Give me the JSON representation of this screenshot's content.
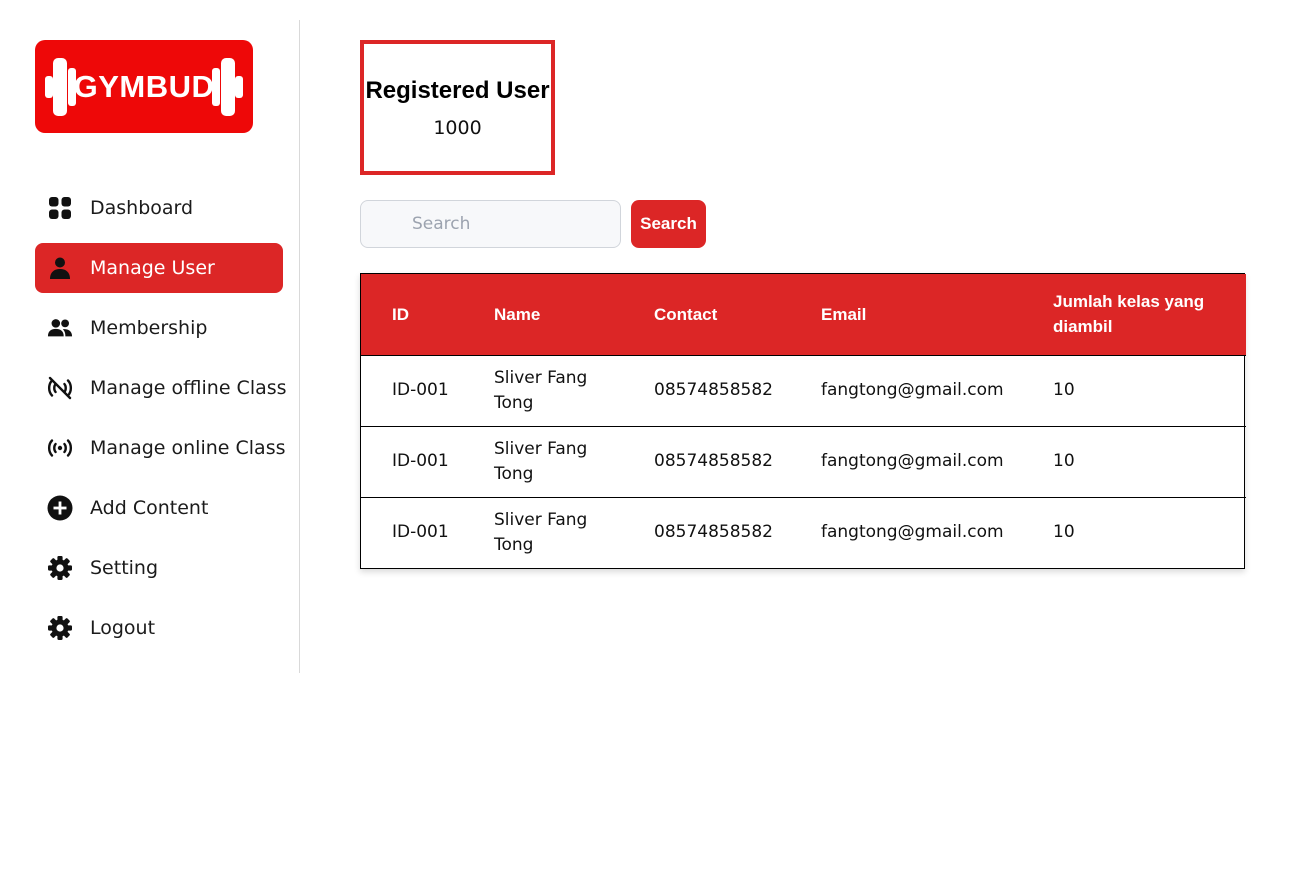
{
  "logo": {
    "text": "GYMBUD"
  },
  "sidebar": {
    "items": [
      {
        "label": "Dashboard",
        "icon": "grid-icon",
        "active": false
      },
      {
        "label": "Manage User",
        "icon": "user-icon",
        "active": true
      },
      {
        "label": "Membership",
        "icon": "users-icon",
        "active": false
      },
      {
        "label": "Manage offline Class",
        "icon": "broadcast-off-icon",
        "active": false
      },
      {
        "label": "Manage online Class",
        "icon": "broadcast-icon",
        "active": false
      },
      {
        "label": "Add Content",
        "icon": "plus-circle-icon",
        "active": false
      },
      {
        "label": "Setting",
        "icon": "gear-icon",
        "active": false
      },
      {
        "label": "Logout",
        "icon": "gear-icon",
        "active": false
      }
    ]
  },
  "stat": {
    "title": "Registered User",
    "value": "1000"
  },
  "search": {
    "placeholder": "Search",
    "value": "",
    "button_label": "Search"
  },
  "table": {
    "headers": [
      "ID",
      "Name",
      "Contact",
      "Email",
      "Jumlah kelas yang diambil"
    ],
    "rows": [
      [
        "ID-001",
        "Sliver Fang Tong",
        "08574858582",
        "fangtong@gmail.com",
        "10"
      ],
      [
        "ID-001",
        "Sliver Fang Tong",
        "08574858582",
        "fangtong@gmail.com",
        "10"
      ],
      [
        "ID-001",
        "Sliver Fang Tong",
        "08574858582",
        "fangtong@gmail.com",
        "10"
      ]
    ]
  },
  "colors": {
    "accent": "#dc2626",
    "logo_bg": "#ee0808"
  }
}
